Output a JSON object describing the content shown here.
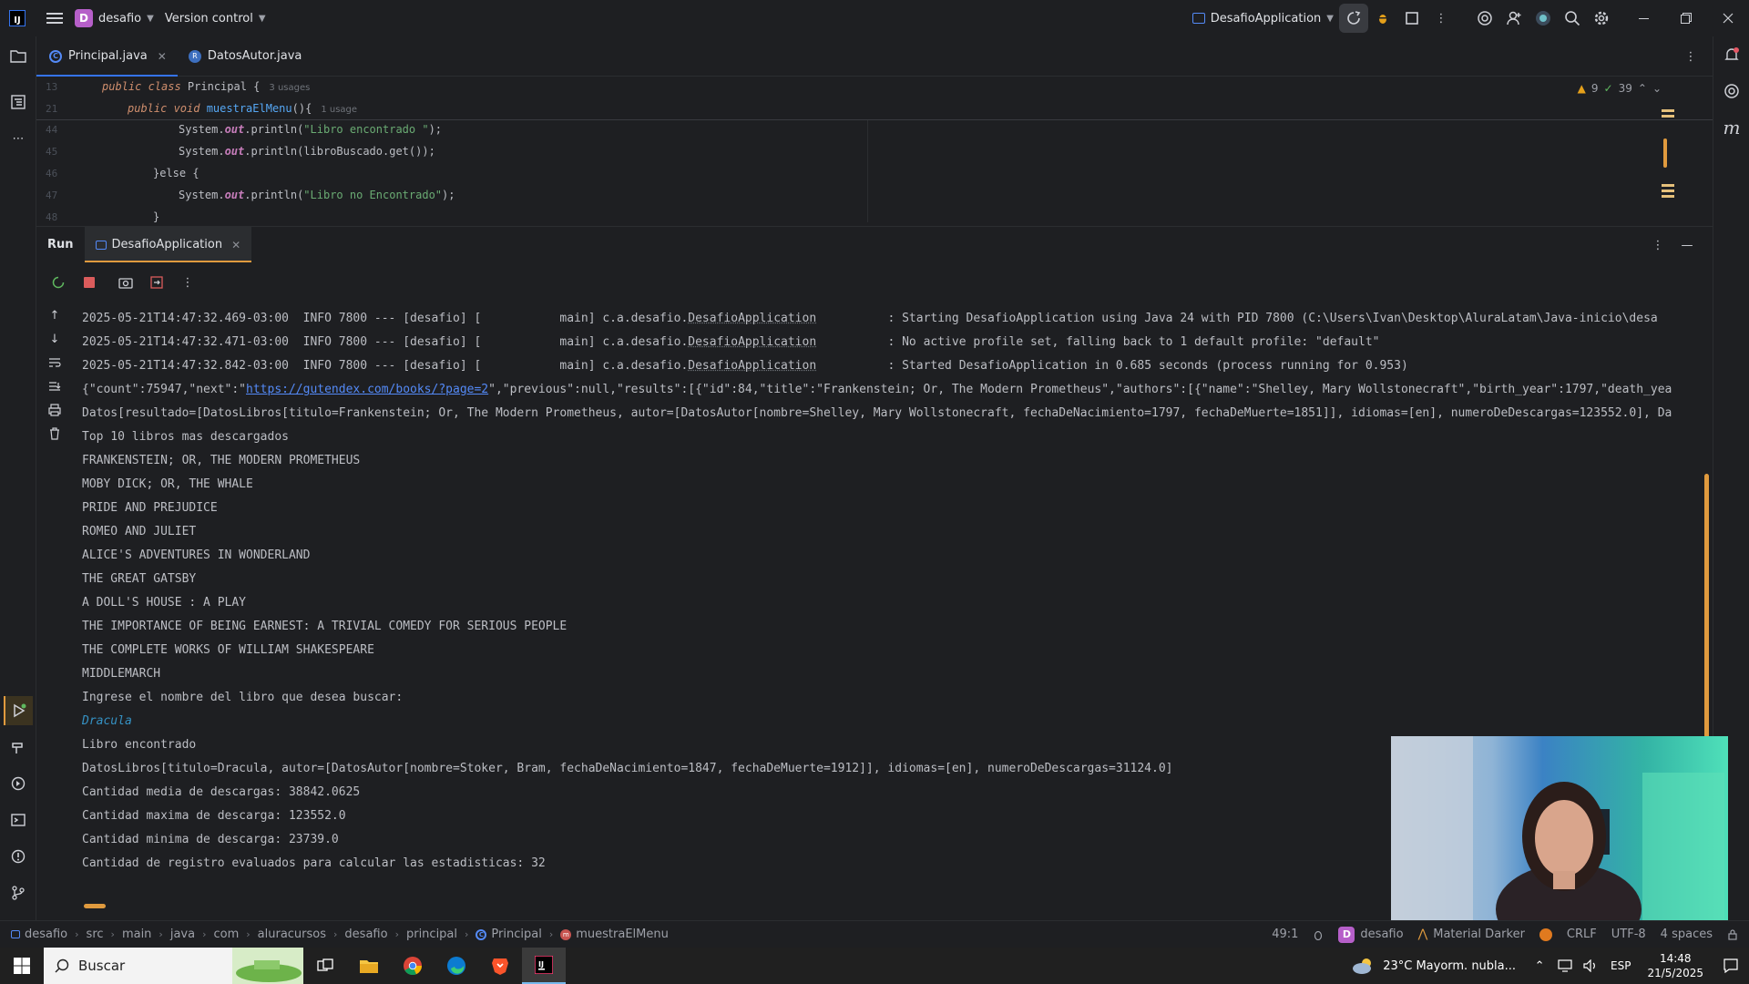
{
  "titlebar": {
    "project_initial": "D",
    "project_name": "desafio",
    "vcs_label": "Version control",
    "run_config": "DesafioApplication"
  },
  "editor_tabs": [
    {
      "label": "Principal.java",
      "active": true
    },
    {
      "label": "DatosAutor.java",
      "active": false
    }
  ],
  "editor": {
    "sticky": [
      {
        "line": "13",
        "hint": "3 usages"
      },
      {
        "line": "21",
        "hint": "1 usage"
      }
    ],
    "lines": [
      "44",
      "45",
      "46",
      "47",
      "48"
    ],
    "code": {
      "l44_str": "\"Libro encontrado \"",
      "l45_arg": "libroBuscado.get()",
      "l46": "}else {",
      "l47_str": "\"Libro no Encontrado\"",
      "l48": "}"
    },
    "inspections": {
      "warnings": "9",
      "ok": "39"
    }
  },
  "run_panel": {
    "title": "Run",
    "tab": "DesafioApplication"
  },
  "console": {
    "log_lines": [
      {
        "prefix": "2025-05-21T14:47:32.469-03:00  INFO 7800 --- [desafio] [           main] c.a.desafio.",
        "cls": "DesafioApplication",
        "msg": "          : Starting DesafioApplication using Java 24 with PID 7800 (C:\\Users\\Ivan\\Desktop\\AluraLatam\\Java-inicio\\desa"
      },
      {
        "prefix": "2025-05-21T14:47:32.471-03:00  INFO 7800 --- [desafio] [           main] c.a.desafio.",
        "cls": "DesafioApplication",
        "msg": "          : No active profile set, falling back to 1 default profile: \"default\""
      },
      {
        "prefix": "2025-05-21T14:47:32.842-03:00  INFO 7800 --- [desafio] [           main] c.a.desafio.",
        "cls": "DesafioApplication",
        "msg": "          : Started DesafioApplication in 0.685 seconds (process running for 0.953)"
      }
    ],
    "json_pre": "{\"count\":75947,\"next\":\"",
    "json_link": "https://gutendex.com/books/?page=2",
    "json_post": "\",\"previous\":null,\"results\":[{\"id\":84,\"title\":\"Frankenstein; Or, The Modern Prometheus\",\"authors\":[{\"name\":\"Shelley, Mary Wollstonecraft\",\"birth_year\":1797,\"death_yea",
    "datos_line": "Datos[resultado=[DatosLibros[titulo=Frankenstein; Or, The Modern Prometheus, autor=[DatosAutor[nombre=Shelley, Mary Wollstonecraft, fechaDeNacimiento=1797, fechaDeMuerte=1851]], idiomas=[en], numeroDeDescargas=123552.0], Da",
    "top_header": "Top 10 libros mas descargados",
    "top_books": [
      "FRANKENSTEIN; OR, THE MODERN PROMETHEUS",
      "MOBY DICK; OR, THE WHALE",
      "PRIDE AND PREJUDICE",
      "ROMEO AND JULIET",
      "ALICE'S ADVENTURES IN WONDERLAND",
      "THE GREAT GATSBY",
      "A DOLL'S HOUSE : A PLAY",
      "THE IMPORTANCE OF BEING EARNEST: A TRIVIAL COMEDY FOR SERIOUS PEOPLE",
      "THE COMPLETE WORKS OF WILLIAM SHAKESPEARE",
      "MIDDLEMARCH"
    ],
    "prompt": "Ingrese el nombre del libro que desea buscar:",
    "user_input": "Dracula",
    "found": "Libro encontrado",
    "result": "DatosLibros[titulo=Dracula, autor=[DatosAutor[nombre=Stoker, Bram, fechaDeNacimiento=1847, fechaDeMuerte=1912]], idiomas=[en], numeroDeDescargas=31124.0]",
    "stats": [
      "Cantidad media de descargas: 38842.0625",
      "Cantidad maxima de descarga: 123552.0",
      "Cantidad minima de descarga: 23739.0",
      "Cantidad de registro evaluados para calcular las estadisticas: 32"
    ]
  },
  "breadcrumbs": [
    "desafio",
    "src",
    "main",
    "java",
    "com",
    "aluracursos",
    "desafio",
    "principal",
    "Principal",
    "muestraElMenu"
  ],
  "status": {
    "position": "49:1",
    "project_initial": "D",
    "project": "desafio",
    "theme": "Material Darker",
    "line_sep": "CRLF",
    "encoding": "UTF-8",
    "indent": "4 spaces"
  },
  "taskbar": {
    "search_placeholder": "Buscar",
    "weather": "23°C  Mayorm. nubla...",
    "lang": "ESP",
    "time": "14:48",
    "date": "21/5/2025"
  },
  "colors": {
    "accent_orange": "#e09a3e",
    "accent_blue": "#3574f0",
    "background": "#1e1f22"
  }
}
